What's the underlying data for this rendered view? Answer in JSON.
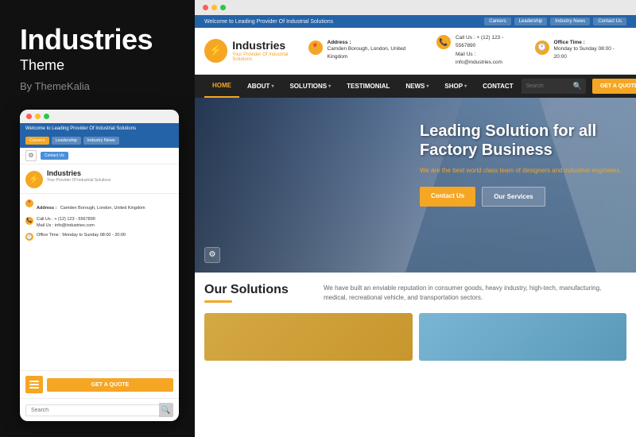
{
  "left": {
    "title": "Industries",
    "subtitle": "Theme",
    "by": "By ThemeKalia"
  },
  "mobile": {
    "topbar": "Welcome to Leading Provider Of Industrial Solutions",
    "pills": [
      "Careers",
      "Leadership",
      "Industry News"
    ],
    "contact_pill": "Contact Us",
    "logo_icon": "⚡",
    "logo_name": "Industries",
    "logo_sub": "Your Provider Of Industrial Solutions",
    "address_label": "Address :",
    "address_value": "Camden Borough, London, United Kingdom",
    "call_label": "Call Us :",
    "call_value": "+ (12) 123 - 5567890",
    "mail_label": "Mail Us :",
    "mail_value": "info@industries.com",
    "office_label": "Office Time :",
    "office_value": "Monday to Sunday 08:00 - 20:00",
    "cta_label": "GET A QUOTE",
    "search_placeholder": "Search"
  },
  "desktop": {
    "topbar": "Welcome to Leading Provider Of Industrial Solutions",
    "topbar_links": [
      "Careers",
      "Leadership",
      "Industry News",
      "Contact Us"
    ],
    "logo_icon": "⚡",
    "logo_name": "Industries",
    "logo_sub": "Your Provider Of Industrial Solutions",
    "address_label": "Address :",
    "address_value": "Camden Borough, London, United Kingdom",
    "call_label": "Call Us :",
    "call_value": "+ (12) 123 - 5567890",
    "mail_label": "Mail Us :",
    "mail_value": "info@industries.com",
    "office_label": "Office Time :",
    "office_value": "Monday to Sunday 08:00 - 20:00",
    "nav_items": [
      "HOME",
      "ABOUT",
      "SOLUTIONS",
      "TESTIMONIAL",
      "NEWS",
      "SHOP",
      "CONTACT"
    ],
    "nav_dropdowns": [
      "ABOUT",
      "SOLUTIONS",
      "NEWS",
      "SHOP"
    ],
    "search_placeholder": "Search",
    "quote_btn": "GET A QUOTE",
    "hero_title": "Leading Solution for all Factory Business",
    "hero_desc": "We are the best world class team of designers and industrial engineers.",
    "hero_btn1": "Contact Us",
    "hero_btn2": "Our Services",
    "solutions_title": "Our Solutions",
    "solutions_desc": "We have built an enviable reputation in consumer goods, heavy industry, high-tech, manufacturing, medical, recreational vehicle, and transportation sectors."
  }
}
